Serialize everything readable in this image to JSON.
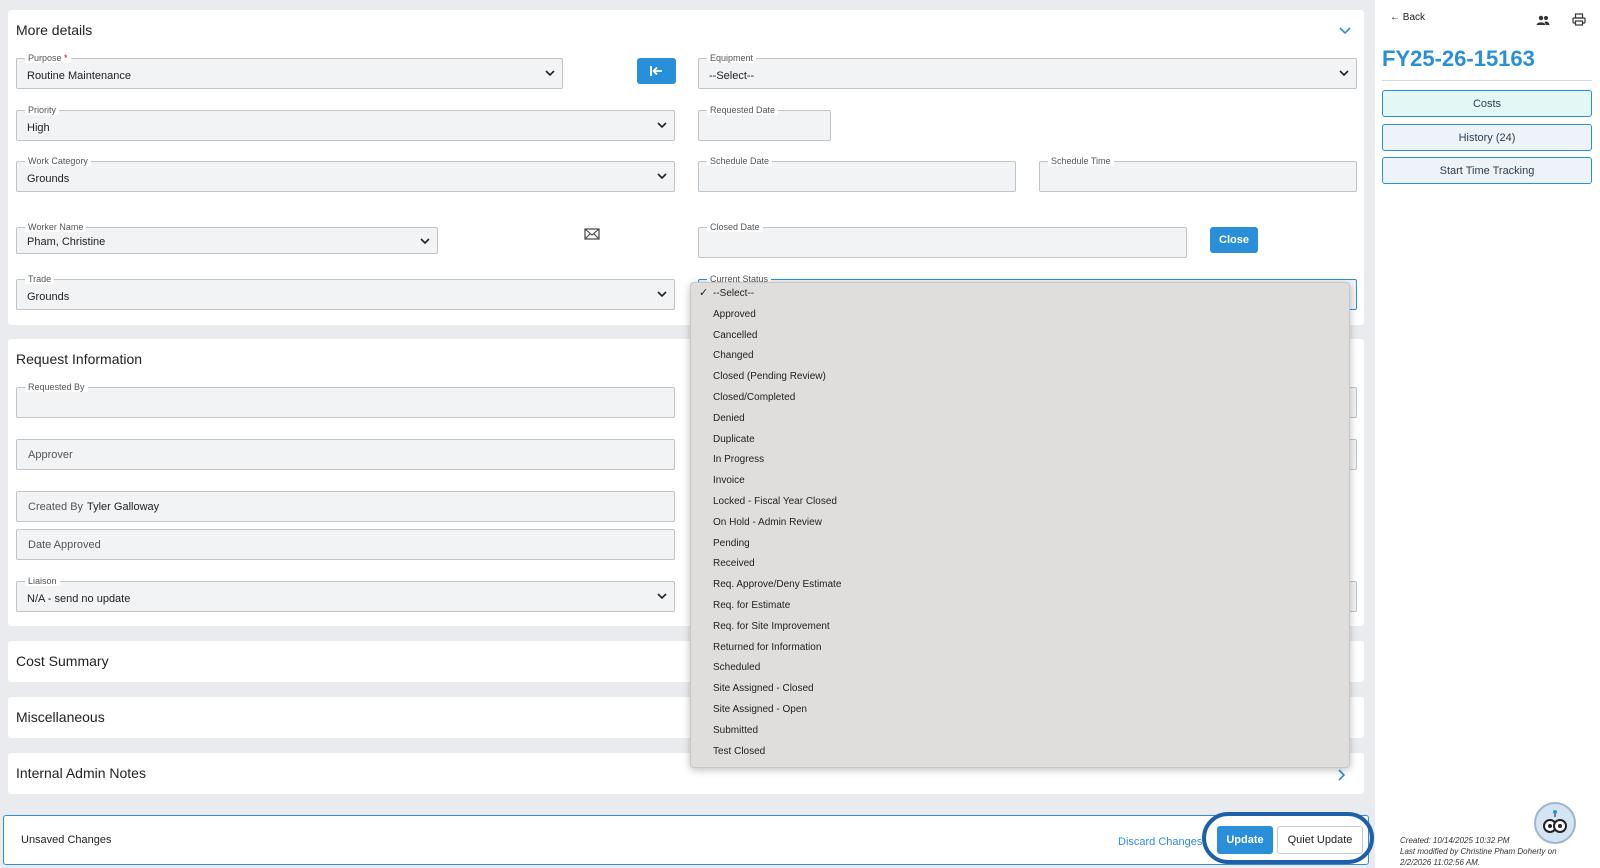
{
  "details": {
    "title": "More details",
    "purpose": {
      "label": "Purpose",
      "required": "*",
      "value": "Routine Maintenance"
    },
    "equipment": {
      "label": "Equipment",
      "value": "--Select--"
    },
    "priority": {
      "label": "Priority",
      "value": "High"
    },
    "requested_date": {
      "label": "Requested Date",
      "value": ""
    },
    "work_category": {
      "label": "Work Category",
      "value": "Grounds"
    },
    "schedule_date": {
      "label": "Schedule Date",
      "value": ""
    },
    "schedule_time": {
      "label": "Schedule Time",
      "value": ""
    },
    "worker_name": {
      "label": "Worker Name",
      "value": "Pham, Christine"
    },
    "closed_date": {
      "label": "Closed Date",
      "value": ""
    },
    "close_button": "Close",
    "trade": {
      "label": "Trade",
      "value": "Grounds"
    },
    "current_status": {
      "label": "Current Status"
    }
  },
  "status_options": [
    "--Select--",
    "Approved",
    "Cancelled",
    "Changed",
    "Closed (Pending Review)",
    "Closed/Completed",
    "Denied",
    "Duplicate",
    "In Progress",
    "Invoice",
    "Locked - Fiscal Year Closed",
    "On Hold - Admin Review",
    "Pending",
    "Received",
    "Req. Approve/Deny Estimate",
    "Req. for Estimate",
    "Req. for Site Improvement",
    "Returned for Information",
    "Scheduled",
    "Site Assigned - Closed",
    "Site Assigned - Open",
    "Submitted",
    "Test Closed"
  ],
  "status_selected": "--Select--",
  "request": {
    "title": "Request Information",
    "requested_by": {
      "label": "Requested By",
      "value": ""
    },
    "approver": {
      "label": "Approver"
    },
    "created_by": {
      "label": "Created By",
      "value": "Tyler Galloway"
    },
    "date_approved": {
      "label": "Date Approved"
    },
    "liaison": {
      "label": "Liaison",
      "value": "N/A - send no update"
    }
  },
  "sections": {
    "cost_summary": "Cost Summary",
    "miscellaneous": "Miscellaneous",
    "internal_admin_notes": "Internal Admin Notes"
  },
  "bottom": {
    "unsaved": "Unsaved Changes",
    "discard": "Discard Changes",
    "update": "Update",
    "quiet_update": "Quiet Update"
  },
  "sidebar": {
    "back": "Back",
    "record_id": "FY25-26-15163",
    "costs": "Costs",
    "history": "History (24)",
    "time_tracking": "Start Time Tracking",
    "created": "Created: 10/14/2025 10:32 PM",
    "modified_1": "Last modified by Christine Pham Doherty on",
    "modified_2": "2/2/2026 11:02:56 AM."
  },
  "colors": {
    "accent": "#2a8fd9",
    "dropdown_bg": "#e0dedd",
    "costs_bg": "#e3f7f4"
  }
}
